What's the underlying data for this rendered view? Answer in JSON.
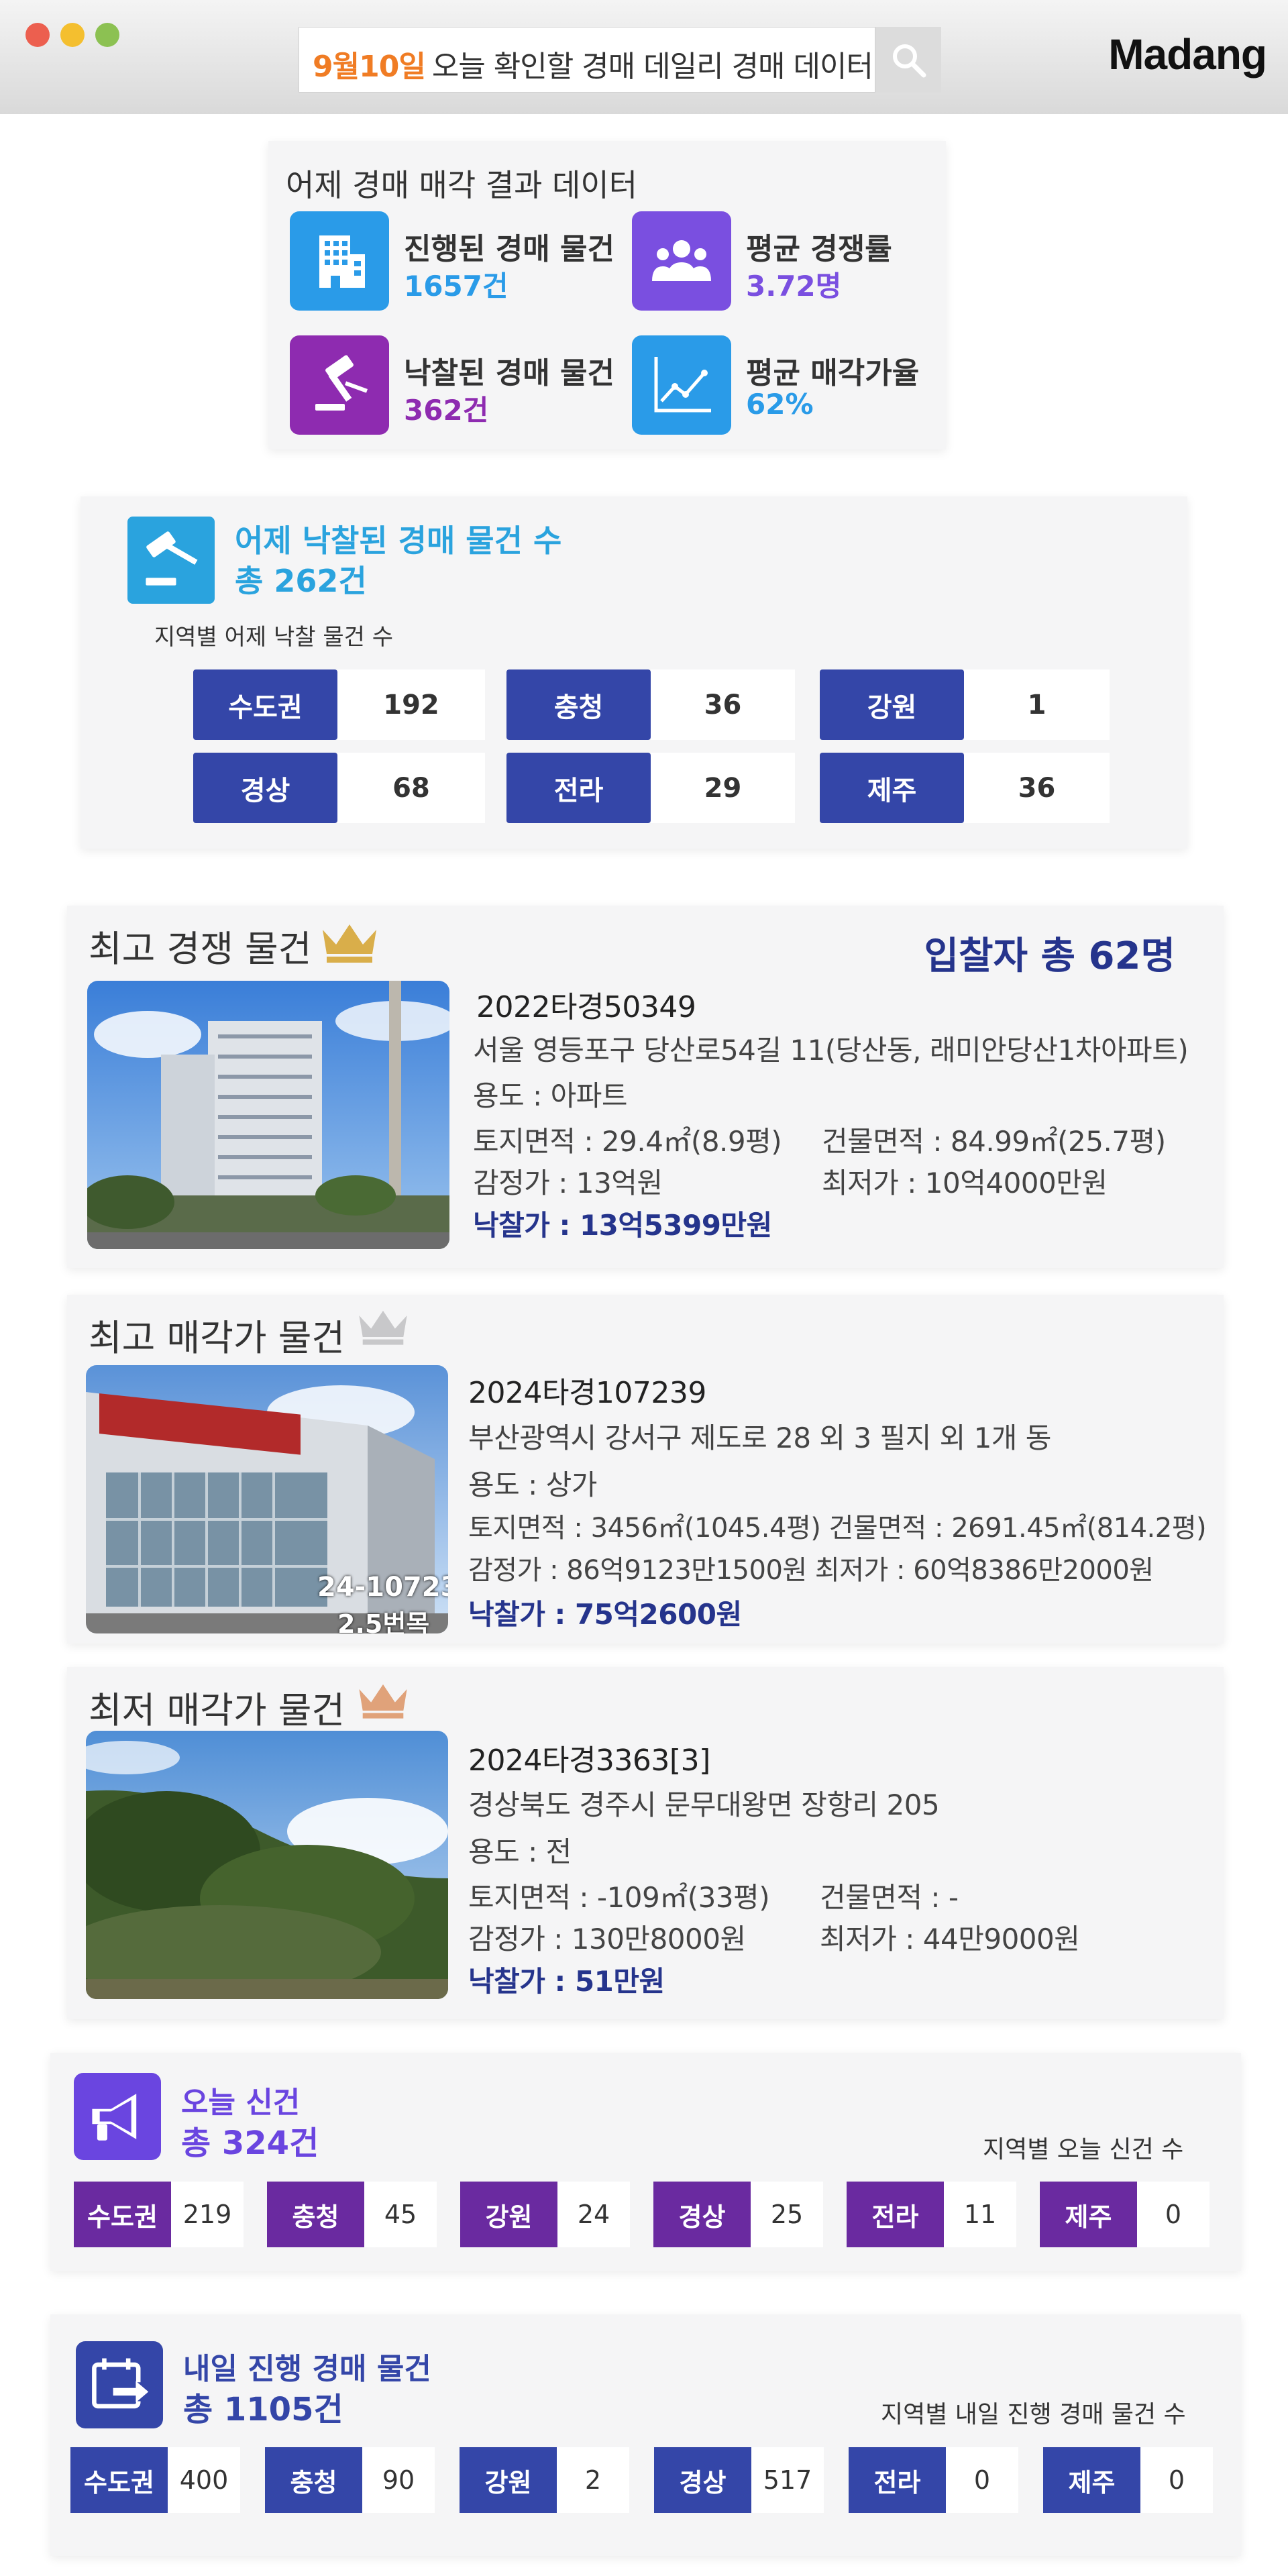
{
  "header": {
    "search_date": "9월10일",
    "search_text": "오늘 확인할 경매 데일리 경매 데이터",
    "brand": "Madang"
  },
  "summary": {
    "title": "어제 경매 매각 결과 데이터",
    "stats": [
      {
        "label": "진행된 경매 물건",
        "value": "1657건",
        "color": "#2a9be8",
        "icon": "building-icon"
      },
      {
        "label": "평균 경쟁률",
        "value": "3.72명",
        "color": "#7a4fe0",
        "icon": "people-icon"
      },
      {
        "label": "낙찰된 경매 물건",
        "value": "362건",
        "color": "#8e2bb0",
        "icon": "gavel-icon"
      },
      {
        "label": "평균 매각가율",
        "value": "62%",
        "color": "#2a9be8",
        "icon": "line-chart-icon"
      }
    ]
  },
  "sold_yesterday": {
    "title": "어제 낙찰된 경매 물건 수",
    "total": "총 262건",
    "subtitle": "지역별 어제 낙찰 물건 수",
    "regions": [
      {
        "name": "수도권",
        "count": "192"
      },
      {
        "name": "충청",
        "count": "36"
      },
      {
        "name": "강원",
        "count": "1"
      },
      {
        "name": "경상",
        "count": "68"
      },
      {
        "name": "전라",
        "count": "29"
      },
      {
        "name": "제주",
        "count": "36"
      }
    ],
    "accent": "#3446a8"
  },
  "top_competition": {
    "title": "최고 경쟁 물건",
    "bidders": "입찰자 총 62명",
    "case_no": "2022타경50349",
    "address": "서울 영등포구 당산로54길 11(당산동, 래미안당산1차아파트)",
    "use": "용도 : 아파트",
    "land_area": "토지면적 : 29.4㎡(8.9평)",
    "building_area": "건물면적 : 84.99㎡(25.7평)",
    "appraised": "감정가 : 13억원",
    "minimum": "최저가 : 10억4000만원",
    "winning_bid": "낙찰가 : 13억5399만원"
  },
  "top_price": {
    "title": "최고 매각가 물건",
    "case_no": "2024타경107239",
    "address": "부산광역시 강서구 제도로 28 외 3 필지 외 1개 동",
    "use": "용도 : 상가",
    "area": "토지면적 : 3456㎡(1045.4평) 건물면적 : 2691.45㎡(814.2평)",
    "prices": "감정가 : 86억9123만1500원   최저가 : 60억8386만2000원",
    "winning_bid": "낙찰가 : 75억2600원",
    "photo_overlay_1": "24-10723",
    "photo_overlay_2": "2.5번목"
  },
  "lowest_price": {
    "title": "최저 매각가 물건",
    "case_no": "2024타경3363[3]",
    "address": "경상북도 경주시 문무대왕면 장항리 205",
    "use": "용도 : 전",
    "land_area": "토지면적 : -109㎡(33평)",
    "building_area": "건물면적 : -",
    "appraised": "감정가 : 130만8000원",
    "minimum": "최저가 : 44만9000원",
    "winning_bid": "낙찰가 : 51만원"
  },
  "new_today": {
    "title": "오늘 신건",
    "total": "총 324건",
    "subtitle": "지역별 오늘 신건 수",
    "accent": "#6a2aa0",
    "regions": [
      {
        "name": "수도권",
        "count": "219"
      },
      {
        "name": "충청",
        "count": "45"
      },
      {
        "name": "강원",
        "count": "24"
      },
      {
        "name": "경상",
        "count": "25"
      },
      {
        "name": "전라",
        "count": "11"
      },
      {
        "name": "제주",
        "count": "0"
      }
    ]
  },
  "tomorrow": {
    "title": "내일 진행 경매 물건",
    "total": "총 1105건",
    "subtitle": "지역별 내일 진행 경매 물건 수",
    "accent": "#3446a8",
    "regions": [
      {
        "name": "수도권",
        "count": "400"
      },
      {
        "name": "충청",
        "count": "90"
      },
      {
        "name": "강원",
        "count": "2"
      },
      {
        "name": "경상",
        "count": "517"
      },
      {
        "name": "전라",
        "count": "0"
      },
      {
        "name": "제주",
        "count": "0"
      }
    ]
  }
}
